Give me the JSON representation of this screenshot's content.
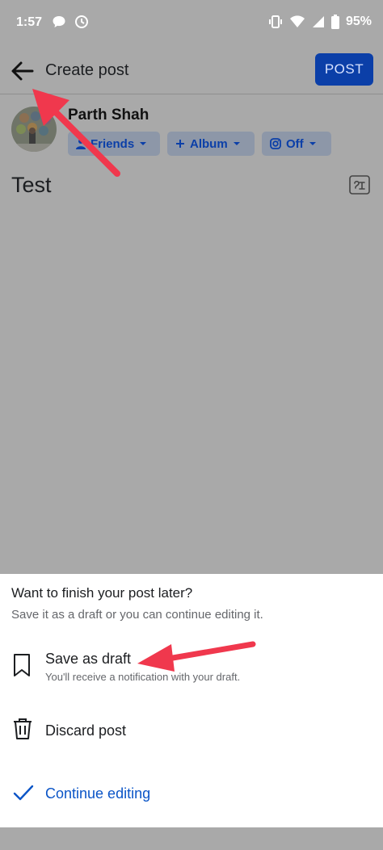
{
  "status_bar": {
    "time": "1:57",
    "battery": "95%",
    "icons": [
      "chat-bubble-icon",
      "recording-icon",
      "vibrate-icon",
      "wifi-icon",
      "signal-icon",
      "battery-icon"
    ]
  },
  "top_bar": {
    "title": "Create post",
    "post_label": "POST"
  },
  "user": {
    "name": "Parth Shah"
  },
  "audience_chips": {
    "friends_label": "Friends",
    "album_label": "Album",
    "instagram_label": "Off"
  },
  "post": {
    "text": "Test"
  },
  "sheet": {
    "title": "Want to finish your post later?",
    "subtitle": "Save it as a draft or you can continue editing it.",
    "save_draft_label": "Save as draft",
    "save_draft_desc": "You'll receive a notification with your draft.",
    "discard_label": "Discard post",
    "continue_label": "Continue editing"
  },
  "colors": {
    "overlay": "#a9a9a9",
    "accent": "#0b3fa8",
    "link": "#0b55c7",
    "annotation_arrow": "#f0384d"
  }
}
